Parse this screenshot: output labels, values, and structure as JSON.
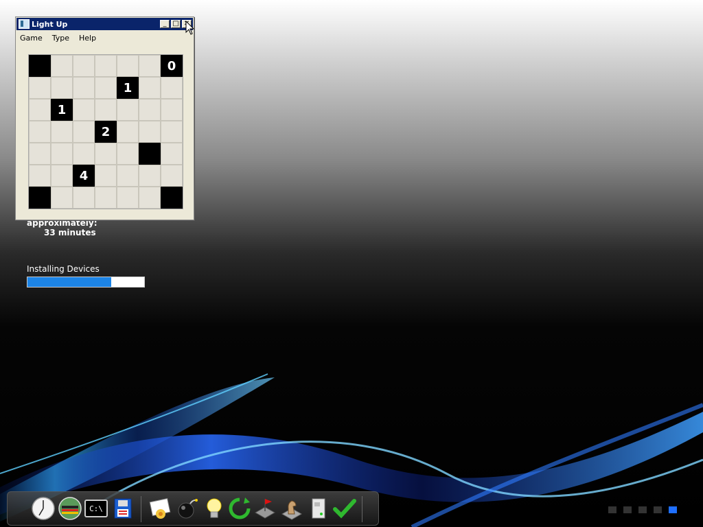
{
  "desktop": {
    "approx_label": "approximately:",
    "minutes_label": "33 minutes",
    "install_label": "Installing Devices",
    "install_progress_percent": 72
  },
  "window": {
    "title": "Light Up",
    "menu": [
      "Game",
      "Type",
      "Help"
    ],
    "buttons": {
      "minimize": "_",
      "maximize": "□",
      "close": "✕"
    }
  },
  "puzzle": {
    "rows": [
      [
        {
          "t": "B",
          "n": ""
        },
        {
          "t": "W",
          "n": ""
        },
        {
          "t": "W",
          "n": ""
        },
        {
          "t": "W",
          "n": ""
        },
        {
          "t": "W",
          "n": ""
        },
        {
          "t": "W",
          "n": ""
        },
        {
          "t": "B",
          "n": "0"
        }
      ],
      [
        {
          "t": "W",
          "n": ""
        },
        {
          "t": "W",
          "n": ""
        },
        {
          "t": "W",
          "n": ""
        },
        {
          "t": "W",
          "n": ""
        },
        {
          "t": "B",
          "n": "1"
        },
        {
          "t": "W",
          "n": ""
        },
        {
          "t": "W",
          "n": ""
        }
      ],
      [
        {
          "t": "W",
          "n": ""
        },
        {
          "t": "B",
          "n": "1"
        },
        {
          "t": "W",
          "n": ""
        },
        {
          "t": "W",
          "n": ""
        },
        {
          "t": "W",
          "n": ""
        },
        {
          "t": "W",
          "n": ""
        },
        {
          "t": "W",
          "n": ""
        }
      ],
      [
        {
          "t": "W",
          "n": ""
        },
        {
          "t": "W",
          "n": ""
        },
        {
          "t": "W",
          "n": ""
        },
        {
          "t": "B",
          "n": "2"
        },
        {
          "t": "W",
          "n": ""
        },
        {
          "t": "W",
          "n": ""
        },
        {
          "t": "W",
          "n": ""
        }
      ],
      [
        {
          "t": "W",
          "n": ""
        },
        {
          "t": "W",
          "n": ""
        },
        {
          "t": "W",
          "n": ""
        },
        {
          "t": "W",
          "n": ""
        },
        {
          "t": "W",
          "n": ""
        },
        {
          "t": "B",
          "n": ""
        },
        {
          "t": "W",
          "n": ""
        }
      ],
      [
        {
          "t": "W",
          "n": ""
        },
        {
          "t": "W",
          "n": ""
        },
        {
          "t": "B",
          "n": "4"
        },
        {
          "t": "W",
          "n": ""
        },
        {
          "t": "W",
          "n": ""
        },
        {
          "t": "W",
          "n": ""
        },
        {
          "t": "W",
          "n": ""
        }
      ],
      [
        {
          "t": "B",
          "n": ""
        },
        {
          "t": "W",
          "n": ""
        },
        {
          "t": "W",
          "n": ""
        },
        {
          "t": "W",
          "n": ""
        },
        {
          "t": "W",
          "n": ""
        },
        {
          "t": "W",
          "n": ""
        },
        {
          "t": "B",
          "n": ""
        }
      ]
    ]
  },
  "dock": {
    "icons": [
      "clock-icon",
      "network-icon",
      "command-prompt-icon",
      "floppy-disk-icon",
      "paint-icon",
      "bomb-icon",
      "lightbulb-icon",
      "refresh-icon",
      "flag-puzzle-icon",
      "chess-knight-icon",
      "server-icon",
      "checkmark-icon"
    ],
    "cmd_text": "C:\\"
  }
}
